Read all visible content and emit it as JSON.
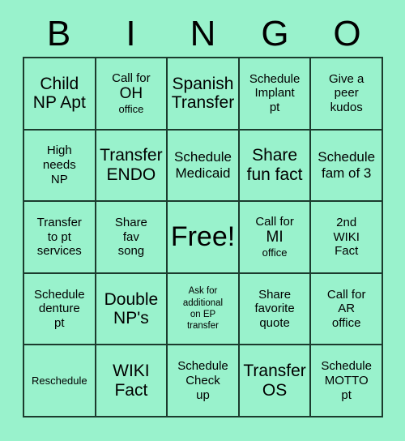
{
  "card": {
    "background_color": "#99F2CC",
    "line_color": "#1c3b2e",
    "text_color": "#000000",
    "header": {
      "letters": [
        "B",
        "I",
        "N",
        "G",
        "O"
      ]
    },
    "grid": {
      "rows": 5,
      "columns": 5,
      "cells": [
        {
          "text": "Child\nNP Apt",
          "size": "lg"
        },
        {
          "text": "Call for\nOH\noffice",
          "size": "multi_ooo"
        },
        {
          "text": "Spanish\nTransfer",
          "size": "lg"
        },
        {
          "text": "Schedule\nImplant\npt",
          "size": "sm"
        },
        {
          "text": "Give a\npeer\nkudos",
          "size": "sm"
        },
        {
          "text": "High\nneeds\nNP",
          "size": "sm"
        },
        {
          "text": "Transfer\nENDO",
          "size": "lg"
        },
        {
          "text": "Schedule\nMedicaid",
          "size": "md"
        },
        {
          "text": "Share\nfun fact",
          "size": "lg"
        },
        {
          "text": "Schedule\nfam of 3",
          "size": "md"
        },
        {
          "text": "Transfer\nto pt\nservices",
          "size": "sm"
        },
        {
          "text": "Share\nfav\nsong",
          "size": "sm"
        },
        {
          "text": "Free!",
          "size": "xl"
        },
        {
          "text": "Call for\nMI\noffice",
          "size": "multi_ooo"
        },
        {
          "text": "2nd\nWIKI\nFact",
          "size": "sm"
        },
        {
          "text": "Schedule\ndenture\npt",
          "size": "sm"
        },
        {
          "text": "Double\nNP's",
          "size": "lg"
        },
        {
          "text": "Ask for\nadditional\non EP\ntransfer",
          "size": "xxs"
        },
        {
          "text": "Share\nfavorite\nquote",
          "size": "sm"
        },
        {
          "text": "Call for\nAR\noffice",
          "size": "sm"
        },
        {
          "text": "Reschedule",
          "size": "xs"
        },
        {
          "text": "WIKI\nFact",
          "size": "lg"
        },
        {
          "text": "Schedule\nCheck\nup",
          "size": "sm"
        },
        {
          "text": "Transfer\nOS",
          "size": "lg"
        },
        {
          "text": "Schedule\nMOTTO\npt",
          "size": "sm"
        }
      ]
    }
  }
}
